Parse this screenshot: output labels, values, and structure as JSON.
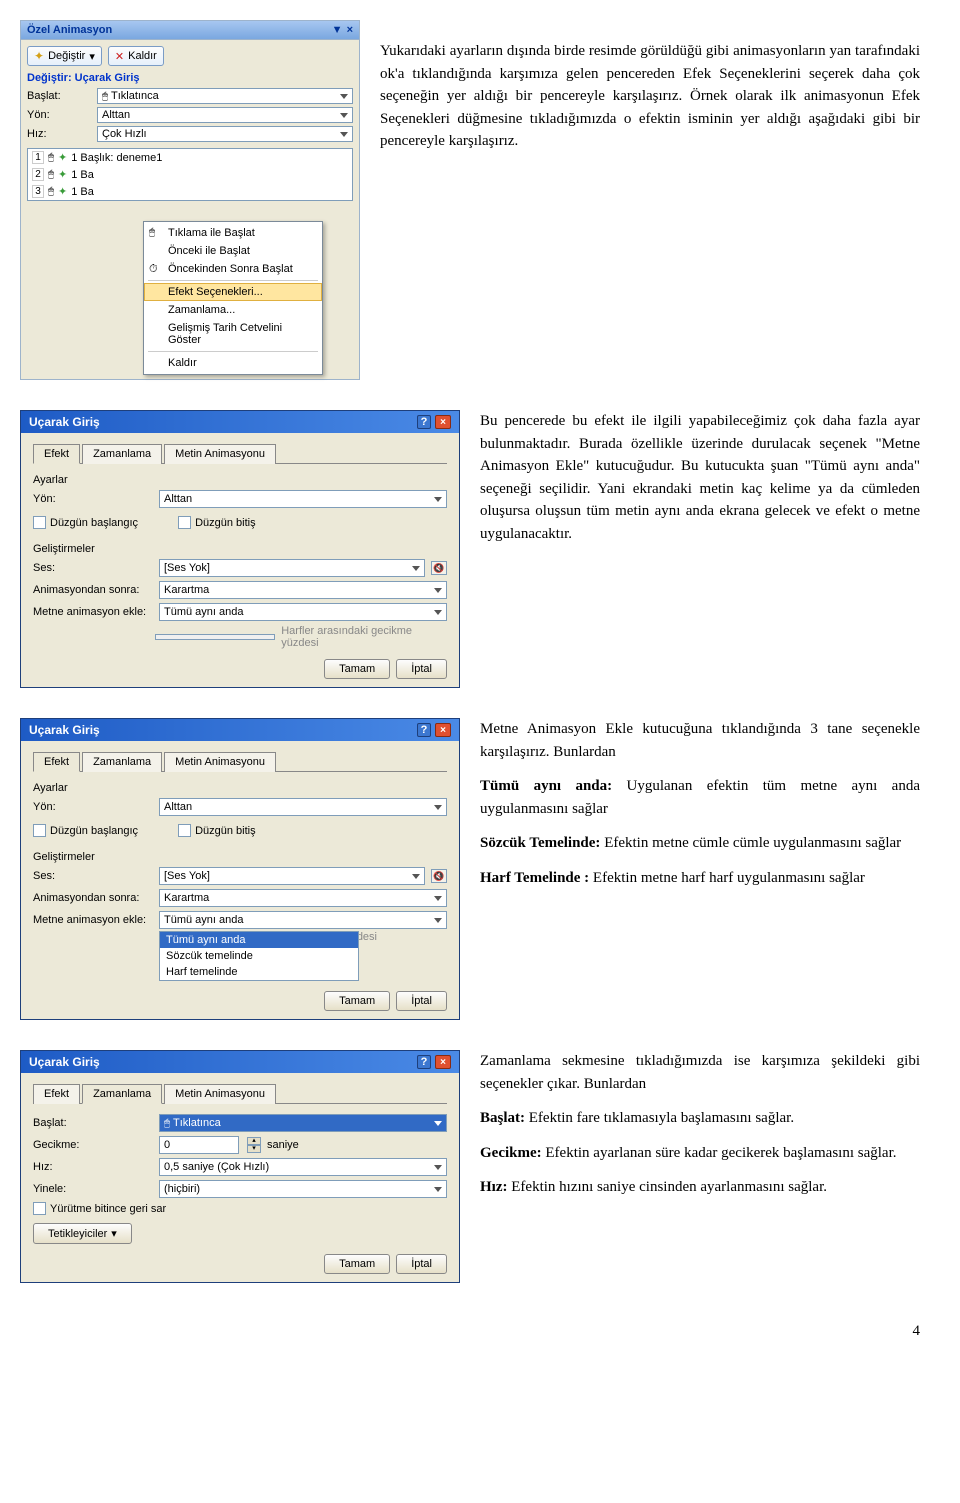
{
  "panel1": {
    "title": "Özel Animasyon",
    "change_btn": "Değiştir",
    "remove_btn": "Kaldır",
    "change_label": "Değiştir: Uçarak Giriş",
    "baslat_lbl": "Başlat:",
    "baslat_val": "Tıklatınca",
    "yon_lbl": "Yön:",
    "yon_val": "Alttan",
    "hiz_lbl": "Hız:",
    "hiz_val": "Çok Hızlı",
    "items": [
      {
        "num": "1",
        "text": "1 Başlık: deneme1"
      },
      {
        "num": "2",
        "text": "1 Ba"
      },
      {
        "num": "3",
        "text": "1 Ba"
      }
    ],
    "menu": {
      "i1": "Tıklama ile Başlat",
      "i2": "Önceki ile Başlat",
      "i3": "Öncekinden Sonra Başlat",
      "i4": "Efekt Seçenekleri...",
      "i5": "Zamanlama...",
      "i6": "Gelişmiş Tarih Cetvelini Göster",
      "i7": "Kaldır"
    }
  },
  "para1": {
    "p1": "Yukarıdaki ayarların dışında birde resimde görüldüğü gibi animasyonların yan tarafındaki ok'a tıklandığında karşımıza gelen pencereden Efek Seçeneklerini seçerek daha çok seçeneğin yer aldığı bir pencereyle karşılaşırız. Örnek olarak ilk animasyonun Efek Seçenekleri düğmesine tıkladığımızda o efektin isminin yer aldığı aşağıdaki gibi bir pencereyle karşılaşırız."
  },
  "dialog1": {
    "title": "Uçarak Giriş",
    "tabs": {
      "efekt": "Efekt",
      "zaman": "Zamanlama",
      "metin": "Metin Animasyonu"
    },
    "ayarlar": "Ayarlar",
    "yon_lbl": "Yön:",
    "yon_val": "Alttan",
    "duzgun_baslangic": "Düzgün başlangıç",
    "duzgun_bitis": "Düzgün bitiş",
    "gelistirmeler": "Geliştirmeler",
    "ses_lbl": "Ses:",
    "ses_val": "[Ses Yok]",
    "anim_sonra_lbl": "Animasyondan sonra:",
    "anim_sonra_val": "Karartma",
    "metin_ekle_lbl": "Metne animasyon ekle:",
    "metin_ekle_val": "Tümü aynı anda",
    "harf_gecikme": "Harfler arasındaki gecikme yüzdesi",
    "tamam": "Tamam",
    "iptal": "İptal"
  },
  "para2": {
    "p1": "Bu pencerede bu efekt ile ilgili yapabileceğimiz çok daha fazla ayar bulunmaktadır. Burada özellikle üzerinde durulacak seçenek \"Metne Animasyon Ekle\" kutucuğudur. Bu kutucukta şuan \"Tümü aynı anda\" seçeneği seçilidir. Yani ekrandaki metin kaç kelime ya da cümleden oluşursa oluşsun tüm metin aynı anda ekrana gelecek ve efekt o metne uygulanacaktır."
  },
  "dialog2": {
    "options": {
      "o1": "Tümü aynı anda",
      "o2": "Sözcük temelinde",
      "o3": "Harf temelinde"
    },
    "footer": "desi"
  },
  "para3": {
    "p1": "Metne Animasyon Ekle kutucuğuna tıklandığında 3 tane seçenekle karşılaşırız. Bunlardan",
    "p2a": "Tümü aynı anda:",
    "p2b": " Uygulanan efektin tüm metne aynı anda uygulanmasını sağlar",
    "p3a": "Sözcük Temelinde:",
    "p3b": " Efektin metne cümle cümle uygulanmasını sağlar",
    "p4a": "Harf Temelinde :",
    "p4b": " Efektin metne harf harf uygulanmasını sağlar"
  },
  "dialog3": {
    "title": "Uçarak Giriş",
    "baslat_lbl": "Başlat:",
    "baslat_val": "Tıklatınca",
    "gecikme_lbl": "Gecikme:",
    "gecikme_val": "0",
    "saniye": "saniye",
    "hiz_lbl": "Hız:",
    "hiz_val": "0,5 saniye (Çok Hızlı)",
    "yinele_lbl": "Yinele:",
    "yinele_val": "(hiçbiri)",
    "yurutme": "Yürütme bitince geri sar",
    "tetik": "Tetikleyiciler"
  },
  "para4": {
    "p1": "Zamanlama sekmesine tıkladığımızda ise karşımıza şekildeki gibi seçenekler çıkar. Bunlardan",
    "p2a": "Başlat:",
    "p2b": " Efektin fare tıklamasıyla başlamasını sağlar.",
    "p3a": "Gecikme:",
    "p3b": " Efektin ayarlanan süre kadar gecikerek başlamasını sağlar.",
    "p4a": "Hız:",
    "p4b": " Efektin hızını saniye cinsinden ayarlanmasını sağlar."
  },
  "page_number": "4"
}
